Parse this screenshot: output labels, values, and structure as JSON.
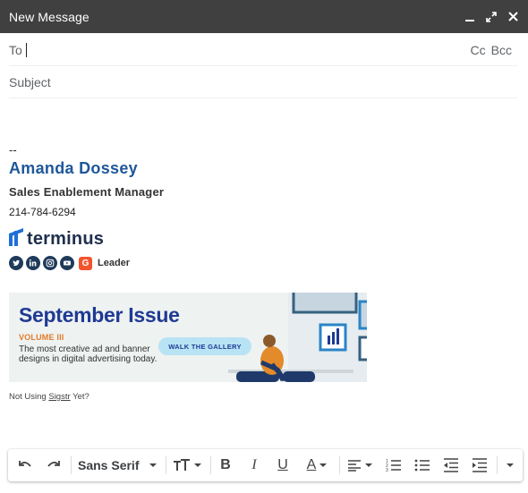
{
  "window": {
    "title": "New Message"
  },
  "fields": {
    "to_label": "To",
    "cc_label": "Cc",
    "bcc_label": "Bcc",
    "subject_placeholder": "Subject"
  },
  "signature": {
    "separator": "--",
    "name": "Amanda Dossey",
    "role": "Sales Enablement Manager",
    "phone": "214-784-6294",
    "company_logo_text": "terminus",
    "social_icons": [
      "twitter-icon",
      "linkedin-icon",
      "instagram-icon",
      "youtube-icon"
    ],
    "badge_letter": "G",
    "badge_label": "Leader",
    "brand_color": "#1e5799"
  },
  "banner": {
    "title": "September Issue",
    "volume": "VOLUME III",
    "description": "The most creative ad and banner designs in digital advertising today.",
    "button_label": "WALK THE GALLERY"
  },
  "footer_note": {
    "prefix": "Not Using",
    "link": "Sigstr",
    "suffix": "Yet?"
  },
  "toolbar": {
    "font_name": "Sans Serif",
    "buttons": [
      "undo-icon",
      "redo-icon",
      "font-size-icon",
      "bold-icon",
      "italic-icon",
      "underline-icon",
      "text-color-icon",
      "align-icon",
      "numbered-list-icon",
      "bulleted-list-icon",
      "indent-less-icon",
      "indent-more-icon",
      "more-formatting-icon"
    ],
    "bold_label": "B",
    "italic_label": "I",
    "underline_label": "U",
    "text_color_label": "A"
  }
}
